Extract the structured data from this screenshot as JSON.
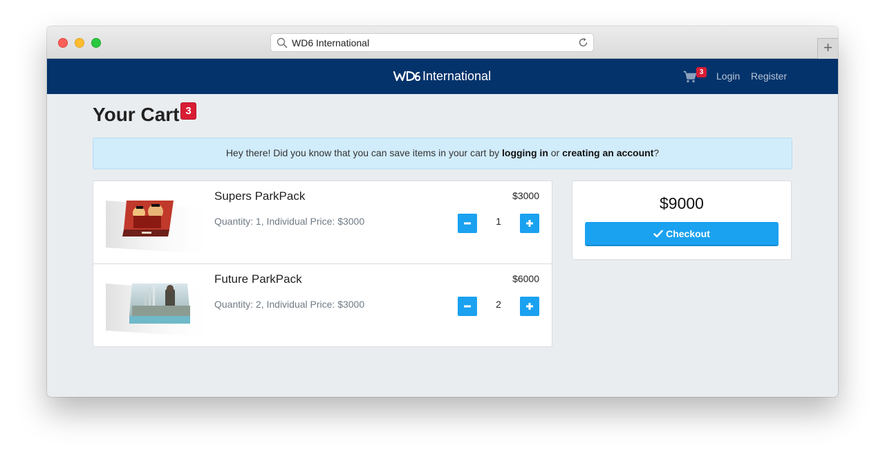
{
  "browser": {
    "url_text": "WD6 International",
    "new_tab_label": "+"
  },
  "navbar": {
    "brand_text": "International",
    "cart_count": "3",
    "login_label": "Login",
    "register_label": "Register"
  },
  "page": {
    "title": "Your Cart",
    "title_badge": "3"
  },
  "alert": {
    "text_before": "Hey there! Did you know that you can save items in your cart by ",
    "link_login": "logging in",
    "text_middle": " or ",
    "link_register": "creating an account",
    "text_after": "?"
  },
  "cart": {
    "items": [
      {
        "name": "Supers ParkPack",
        "description": "Quantity: 1, Individual Price: $3000",
        "price": "$3000",
        "quantity": "1"
      },
      {
        "name": "Future ParkPack",
        "description": "Quantity: 2, Individual Price: $3000",
        "price": "$6000",
        "quantity": "2"
      }
    ]
  },
  "summary": {
    "total": "$9000",
    "checkout_label": "Checkout"
  },
  "colors": {
    "navbar": "#04336b",
    "accent": "#1aa1f0",
    "badge": "#d81d34",
    "alert_bg": "#d1ecfb",
    "page_bg": "#eaedf0"
  }
}
